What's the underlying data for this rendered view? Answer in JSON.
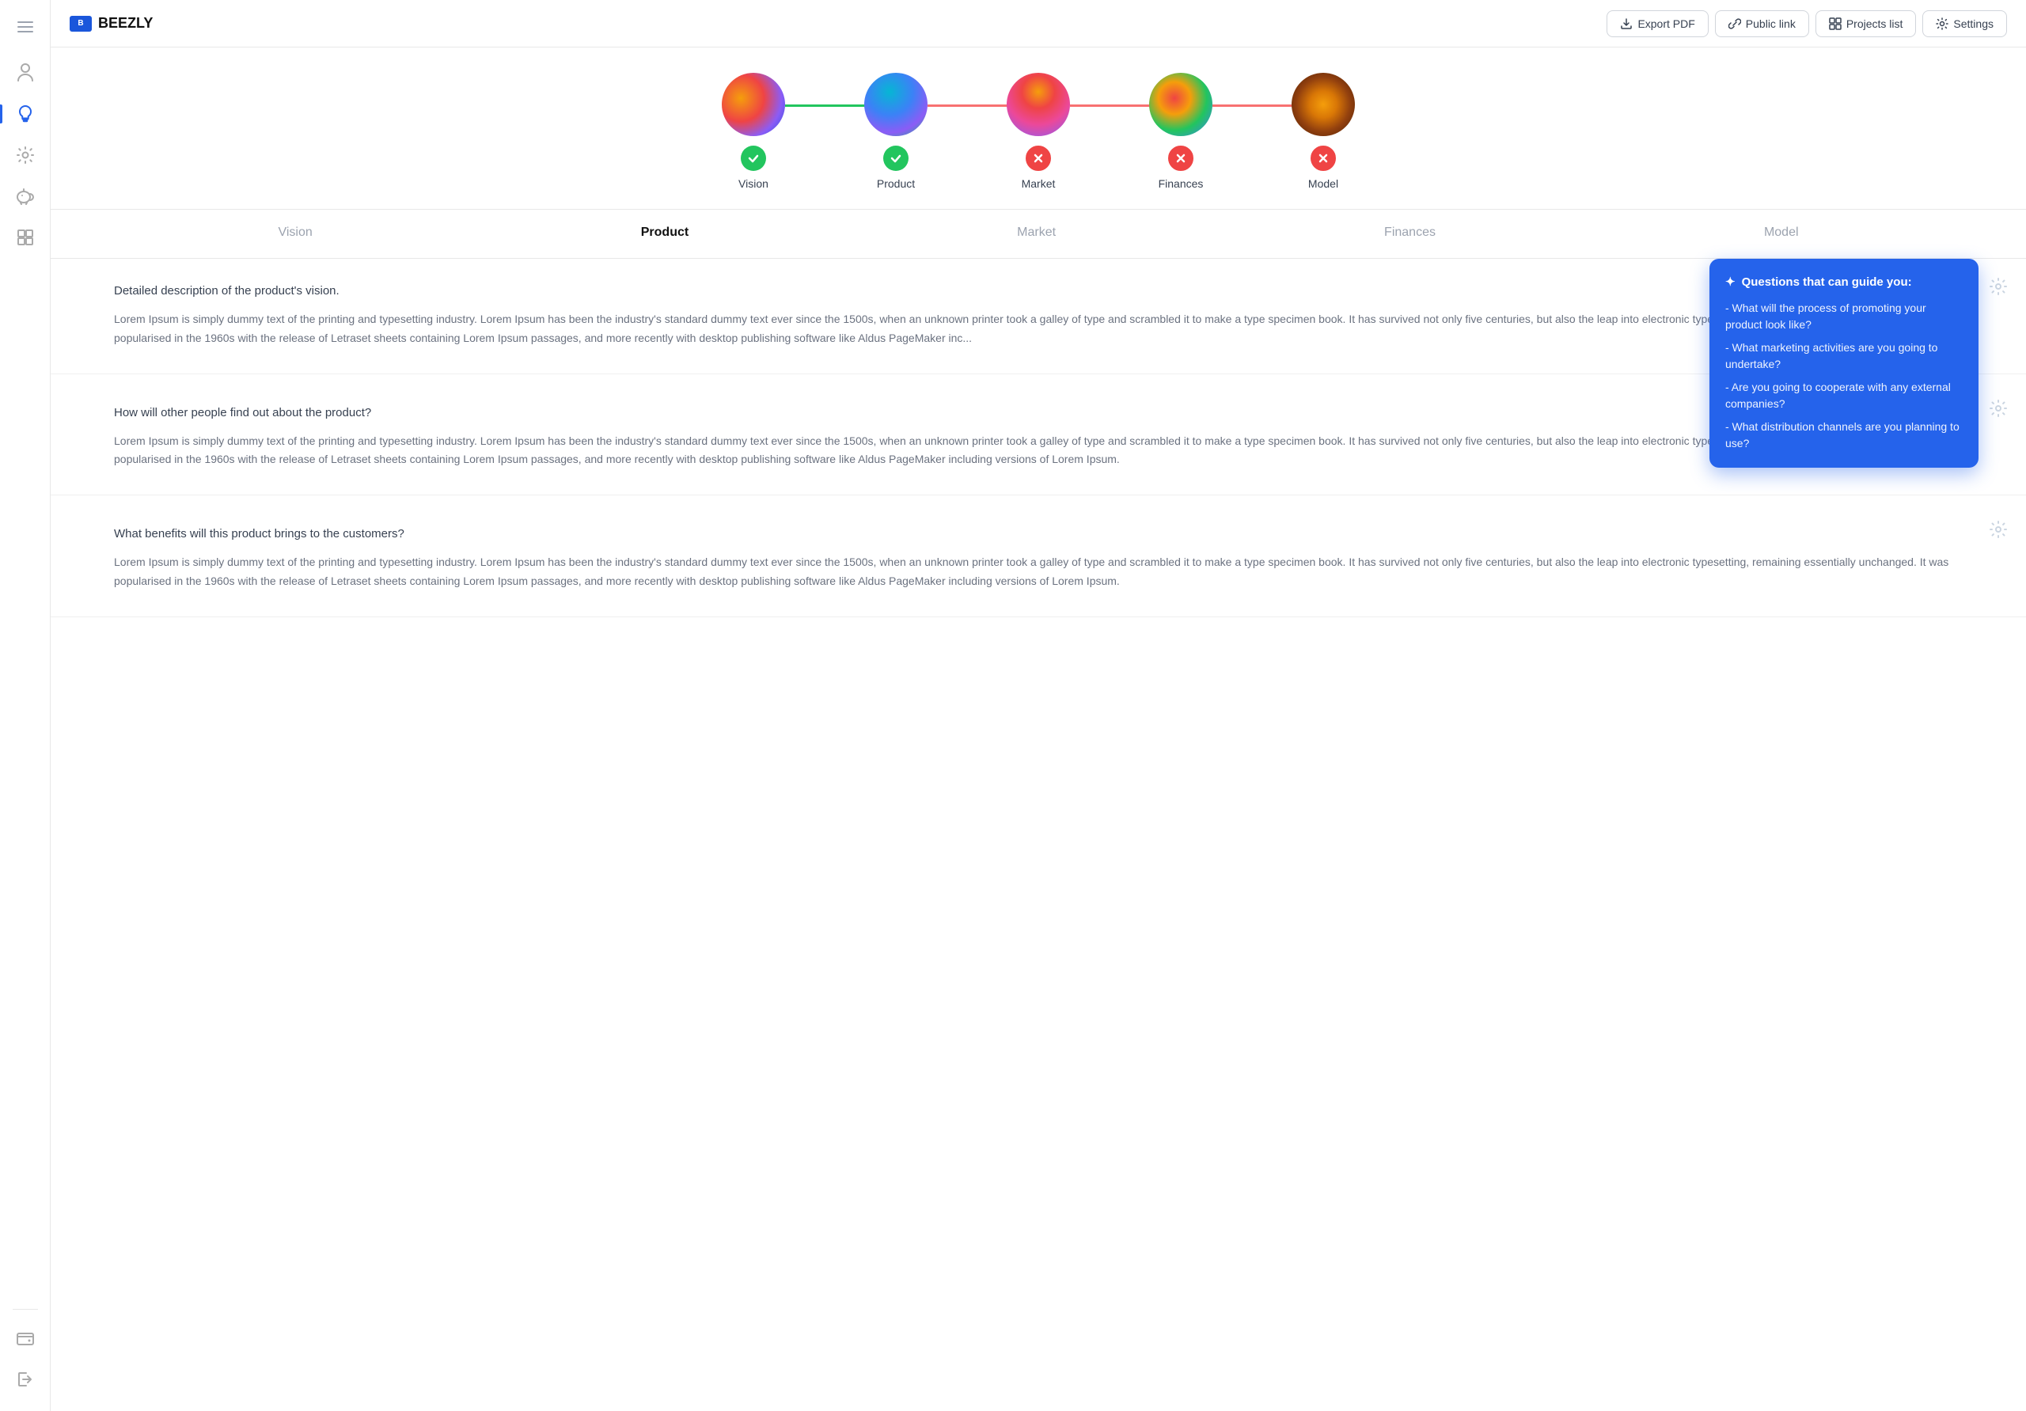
{
  "app": {
    "name": "BEEZLY"
  },
  "header": {
    "export_label": "Export PDF",
    "public_link_label": "Public link",
    "projects_list_label": "Projects list",
    "settings_label": "Settings"
  },
  "progress_steps": [
    {
      "id": "vision",
      "label": "Vision",
      "status": "success",
      "connector": "green",
      "avatar_class": "avatar-1"
    },
    {
      "id": "product",
      "label": "Product",
      "status": "success",
      "connector": "red",
      "avatar_class": "avatar-2"
    },
    {
      "id": "market",
      "label": "Market",
      "status": "error",
      "connector": "red",
      "avatar_class": "avatar-3"
    },
    {
      "id": "finances",
      "label": "Finances",
      "status": "error",
      "connector": "red",
      "avatar_class": "avatar-4"
    },
    {
      "id": "model",
      "label": "Model",
      "status": "error",
      "connector": null,
      "avatar_class": "avatar-5"
    }
  ],
  "tabs": [
    {
      "id": "vision",
      "label": "Vision",
      "active": false
    },
    {
      "id": "product",
      "label": "Product",
      "active": true
    },
    {
      "id": "market",
      "label": "Market",
      "active": false
    },
    {
      "id": "finances",
      "label": "Finances",
      "active": false
    },
    {
      "id": "model",
      "label": "Model",
      "active": false
    }
  ],
  "sections": [
    {
      "id": "section-1",
      "question": "Detailed description of the product's vision.",
      "text": "Lorem Ipsum is simply dummy text of the printing and typesetting industry. Lorem Ipsum has been the industry's standard dummy text ever since the 1500s, when an unknown printer took a galley of type and scrambled it to make a type specimen book. It has survived not only five centuries, but also the leap into electronic typesetting, remaining essentially unchanged. It was popularised in the 1960s with the release of Letraset sheets containing Lorem Ipsum passages, and more recently with desktop publishing software like Aldus PageMaker inc...",
      "has_guide": true
    },
    {
      "id": "section-2",
      "question": "How will other people find out about the product?",
      "text": "Lorem Ipsum is simply dummy text of the printing and typesetting industry. Lorem Ipsum has been the industry's standard dummy text ever since the 1500s, when an unknown printer took a galley of type and scrambled it to make a type specimen book. It has survived not only five centuries, but also the leap into electronic typesetting, remaining essentially unchanged. It was popularised in the 1960s with the release of Letraset sheets containing Lorem Ipsum passages, and more recently with desktop publishing software like Aldus PageMaker including versions of Lorem Ipsum.",
      "has_guide": false
    },
    {
      "id": "section-3",
      "question": "What benefits will this product brings to the customers?",
      "text": "Lorem Ipsum is simply dummy text of the printing and typesetting industry. Lorem Ipsum has been the industry's standard dummy text ever since the 1500s, when an unknown printer took a galley of type and scrambled it to make a type specimen book. It has survived not only five centuries, but also the leap into electronic typesetting, remaining essentially unchanged. It was popularised in the 1960s with the release of Letraset sheets containing Lorem Ipsum passages, and more recently with desktop publishing software like Aldus PageMaker including versions of Lorem Ipsum.",
      "has_guide": false
    }
  ],
  "guide_popup": {
    "title": "Questions that can guide you:",
    "questions": [
      "- What will the process of promoting your product look like?",
      "- What marketing activities are you going to undertake?",
      "- Are you going to cooperate with any external companies?",
      "- What distribution channels are you planning to use?"
    ]
  },
  "sidebar": {
    "items": [
      {
        "id": "figure",
        "icon": "figure"
      },
      {
        "id": "bulb",
        "icon": "bulb",
        "active": true
      },
      {
        "id": "cog",
        "icon": "cog"
      },
      {
        "id": "piggy",
        "icon": "piggy"
      },
      {
        "id": "puzzle",
        "icon": "puzzle"
      }
    ],
    "bottom_items": [
      {
        "id": "wallet",
        "icon": "wallet"
      },
      {
        "id": "logout",
        "icon": "logout"
      }
    ]
  }
}
